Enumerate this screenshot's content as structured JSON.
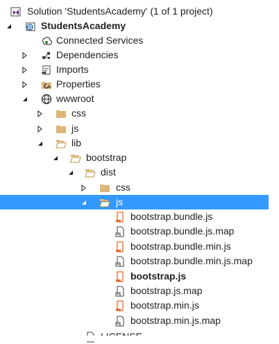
{
  "solution": {
    "label": "Solution 'StudentsAcademy' (1 of 1 project)",
    "icon": "solution-icon"
  },
  "project": {
    "label": "StudentsAcademy",
    "icon": "project-icon"
  },
  "nodes": {
    "connected_services": "Connected Services",
    "dependencies": "Dependencies",
    "imports": "Imports",
    "properties": "Properties",
    "wwwroot": "wwwroot",
    "css": "css",
    "js": "js",
    "lib": "lib",
    "bootstrap": "bootstrap",
    "dist": "dist",
    "dist_css": "css",
    "dist_js": "js"
  },
  "files": [
    {
      "name": "bootstrap.bundle.js",
      "icon": "js-file-icon"
    },
    {
      "name": "bootstrap.bundle.js.map",
      "icon": "map-file-icon"
    },
    {
      "name": "bootstrap.bundle.min.js",
      "icon": "js-file-icon"
    },
    {
      "name": "bootstrap.bundle.min.js.map",
      "icon": "map-file-icon"
    },
    {
      "name": "bootstrap.js",
      "icon": "js-file-icon"
    },
    {
      "name": "bootstrap.js.map",
      "icon": "map-file-icon"
    },
    {
      "name": "bootstrap.min.js",
      "icon": "js-file-icon"
    },
    {
      "name": "bootstrap.min.js.map",
      "icon": "map-file-icon"
    }
  ],
  "partial_row": {
    "label": "LICENSE"
  },
  "colors": {
    "selection": "#3399ff",
    "folder": "#dcb67a",
    "js_file": "#e8692e",
    "text": "#1e1e1e",
    "solution_purple": "#68217a"
  }
}
